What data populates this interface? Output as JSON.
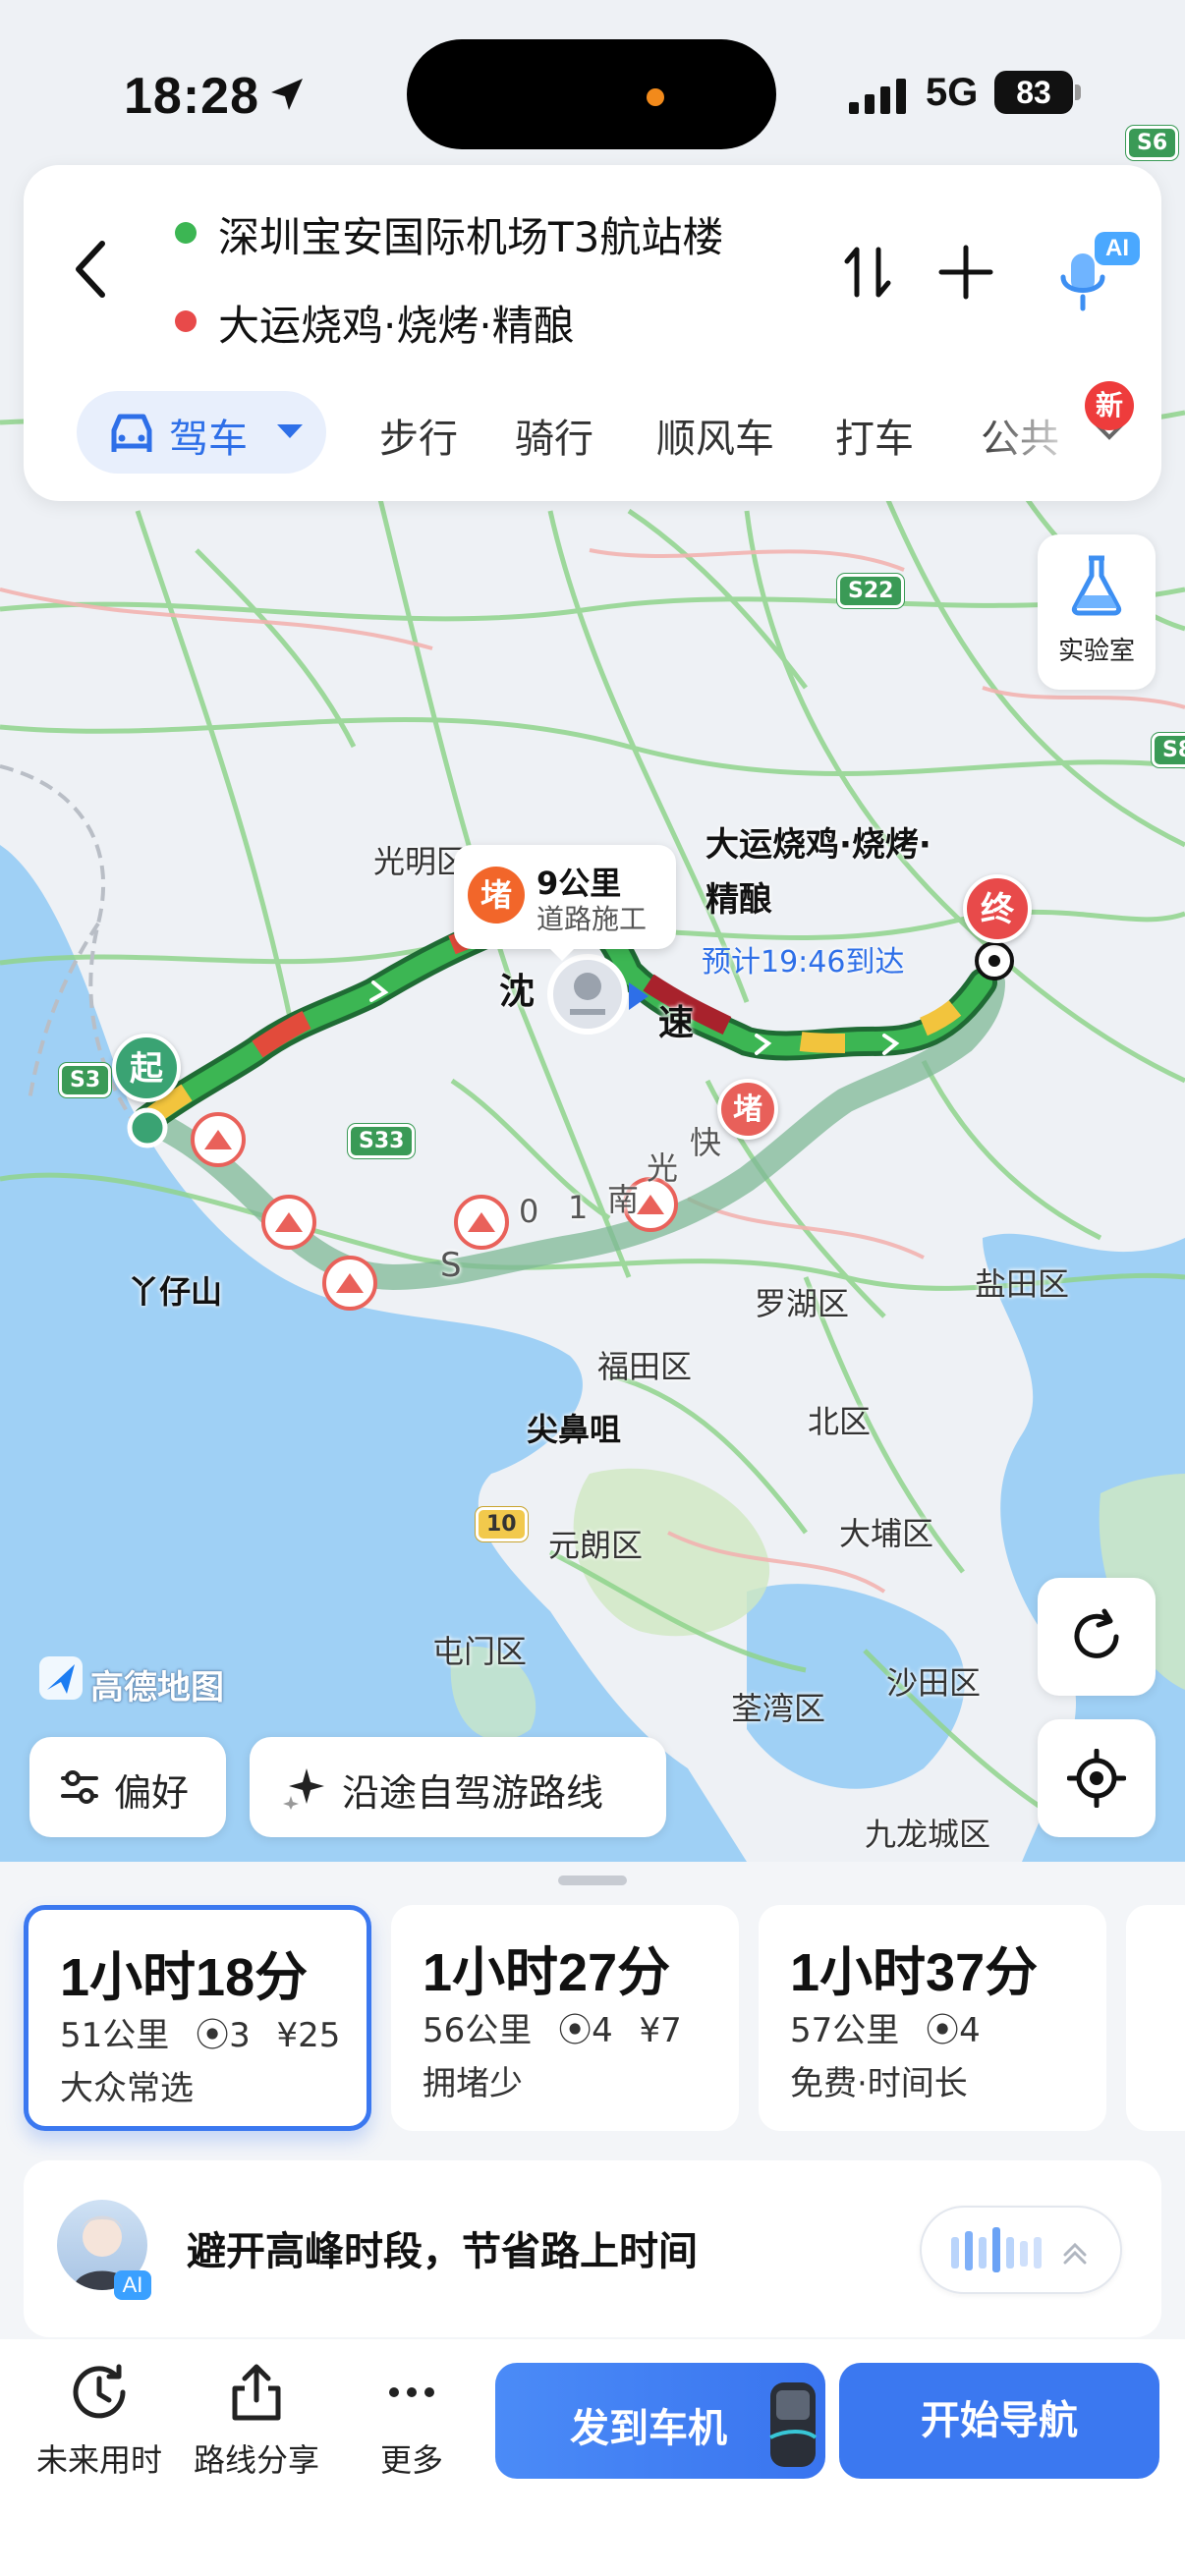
{
  "status_bar": {
    "time": "18:28",
    "network": "5G",
    "battery": "83"
  },
  "route": {
    "origin": "深圳宝安国际机场T3航站楼",
    "destination": "大运烧鸡·烧烤·精酿"
  },
  "modes": {
    "active": "驾车",
    "items": [
      "步行",
      "骑行",
      "顺风车",
      "打车",
      "公共"
    ],
    "new_badge": "新"
  },
  "ai_badge": "AI",
  "lab_label": "实验室",
  "map": {
    "labels": [
      "光明区",
      "丫仔山",
      "罗湖区",
      "盐田区",
      "福田区",
      "北区",
      "尖鼻咀",
      "大埔区",
      "元朗区",
      "屯门区",
      "荃湾区",
      "沙田区",
      "九龙城区"
    ],
    "shields": [
      "S3",
      "S33",
      "S22",
      "S6",
      "S8",
      "10"
    ],
    "jam": {
      "icon": "堵",
      "distance": "9公里",
      "reason": "道路施工"
    },
    "jam_marker": "堵",
    "destination_name": "大运烧鸡·烧烤·精酿",
    "eta": "预计19:46到达",
    "start_pin": "起",
    "end_pin": "终",
    "road_chars": [
      "沈",
      "速",
      "S",
      "0",
      "1",
      "南",
      "光",
      "快"
    ],
    "logo": "高德地图"
  },
  "buttons": {
    "preference": "偏好",
    "scenic_route": "沿途自驾游路线"
  },
  "route_options": [
    {
      "duration": "1小时18分",
      "distance": "51公里",
      "lights": "3",
      "toll": "¥25",
      "tag": "大众常选",
      "selected": true
    },
    {
      "duration": "1小时27分",
      "distance": "56公里",
      "lights": "4",
      "toll": "¥7",
      "tag": "拥堵少",
      "selected": false
    },
    {
      "duration": "1小时37分",
      "distance": "57公里",
      "lights": "4",
      "toll": "",
      "tag": "免费·时间长",
      "selected": false
    }
  ],
  "ai_banner": {
    "tag": "AI",
    "text": "避开高峰时段，节省路上时间"
  },
  "footer": {
    "future": "未来用时",
    "share": "路线分享",
    "more": "更多",
    "send_to_car": "发到车机",
    "start_nav": "开始导航"
  },
  "colors": {
    "accent": "#3b78f0",
    "jam": "#f2662a",
    "end": "#e84a4a",
    "start": "#3aa373",
    "route_smooth": "#3cb653"
  }
}
